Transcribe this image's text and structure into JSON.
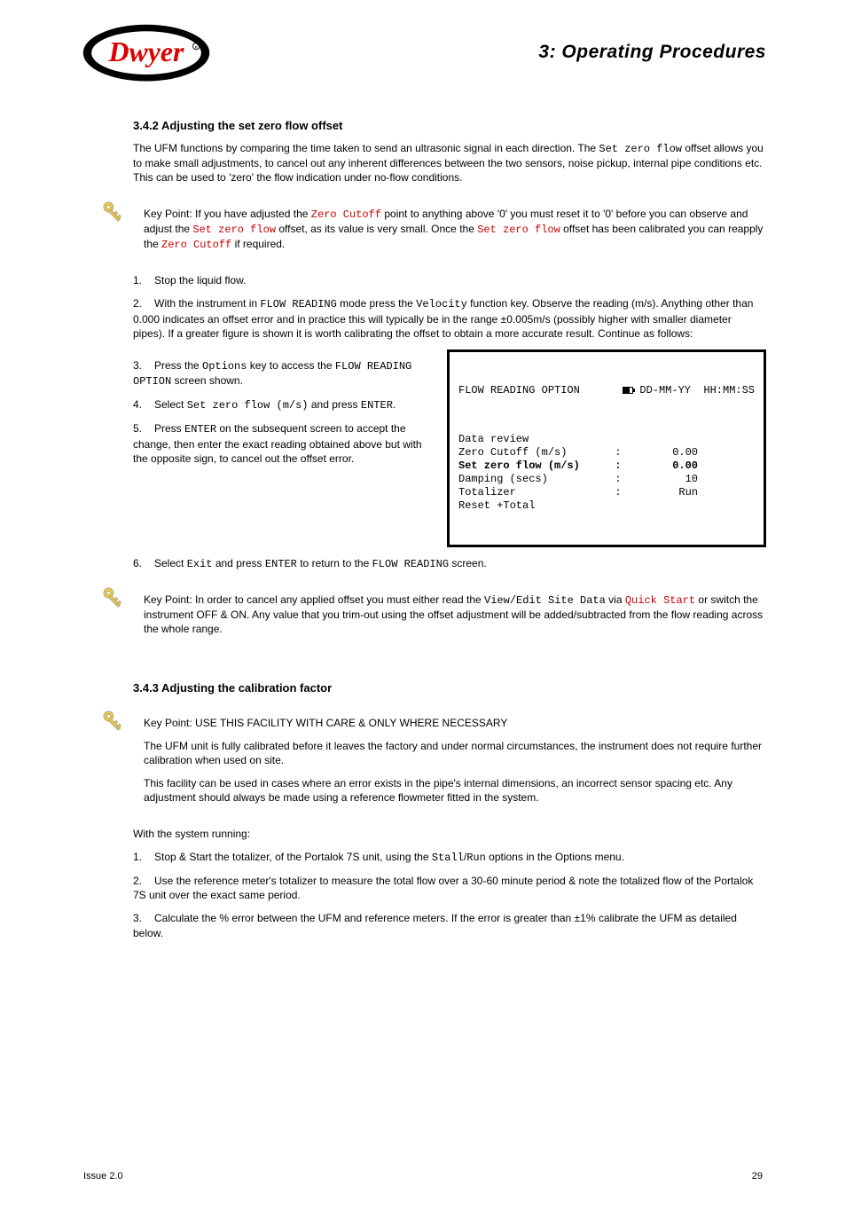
{
  "header": {
    "chapter": "3:  Operating Procedures",
    "logo_name": "dwyer-logo"
  },
  "section1": {
    "heading": "3.4.2 Adjusting the set zero flow offset",
    "para1_pre": "The UFM functions by comparing the time taken to send an ultrasonic signal in each direction. The ",
    "para1_code": "Set zero flow",
    "para1_post": " offset allows you to make small adjustments, to cancel out any inherent differences between the two sensors, noise pickup, internal pipe conditions etc. This can be used to 'zero' the flow indication under no-flow conditions.",
    "keypoint_pre": "If you have adjusted the ",
    "keypoint_k1": "Zero Cutoff",
    "keypoint_mid1": " point to anything above '0' you must reset it to '0' before you can observe and adjust the ",
    "keypoint_k2": "Set zero flow",
    "keypoint_mid2": " offset, as its value is very small. Once the ",
    "keypoint_k3": "Set zero flow",
    "keypoint_mid3": " offset has been calibrated you can reapply the ",
    "keypoint_k4": "Zero Cutoff",
    "keypoint_post": " if required.",
    "steps": {
      "s1": "Stop the liquid flow.",
      "s2_a": "With the instrument in ",
      "s2_code1": "FLOW READING",
      "s2_b": " mode press the ",
      "s2_code2": "Velocity",
      "s2_c": " function key. Observe the reading (m/s). Anything other than 0.000 indicates an offset error and in practice this will typically be in the range ±0.005m/s (possibly higher with smaller diameter pipes). If a greater figure is shown it is worth calibrating the offset to obtain a more accurate result. Continue as follows:",
      "s3_a": "Press the ",
      "s3_code1": "Options",
      "s3_b": " key to access the ",
      "s3_code2": "FLOW READING OPTION",
      "s3_c": " screen shown.",
      "s4_a": "Select ",
      "s4_code1": "Set zero flow (m/s)",
      "s4_b": " and press ",
      "s4_code2": "ENTER",
      "s4_c": ".",
      "s5_a": "Press ",
      "s5_code1": "ENTER",
      "s5_b": " on the subsequent screen to accept the change, then enter the exact reading obtained above but with the opposite sign, to cancel out the offset error.",
      "s6_a": "Select ",
      "s6_code1": "Exit",
      "s6_b": " and press ",
      "s6_code2": "ENTER",
      "s6_c": " to return to the ",
      "s6_code3": "FLOW READING",
      "s6_d": " screen."
    }
  },
  "screen": {
    "title": "FLOW READING OPTION",
    "date": "DD-MM-YY",
    "time": "HH:MM:SS",
    "rows": [
      {
        "label": "Data review",
        "sep": "",
        "val": "",
        "bold": false
      },
      {
        "label": "Zero Cutoff (m/s)",
        "sep": ":",
        "val": "0.00",
        "bold": false
      },
      {
        "label": "Set zero flow (m/s)",
        "sep": ":",
        "val": "0.00",
        "bold": true
      },
      {
        "label": "Damping (secs)",
        "sep": ":",
        "val": "10",
        "bold": false
      },
      {
        "label": "Totalizer",
        "sep": ":",
        "val": "Run",
        "bold": false
      },
      {
        "label": "Reset +Total",
        "sep": "",
        "val": "",
        "bold": false
      }
    ]
  },
  "note1_pre": "In order to cancel any applied offset you must either read the ",
  "note1_mid": " via ",
  "note1_k1": "Quick Start",
  "note1_post": " or switch the instrument OFF & ON. Any value that you trim-out using the offset adjustment will be added/subtracted from the flow reading across the whole range.",
  "note1_code_view": "View/Edit Site Data",
  "section2": {
    "heading": "3.4.3 Adjusting the calibration factor",
    "keypoint": "USE THIS FACILITY WITH CARE & ONLY WHERE NECESSARY",
    "keypoint2": "The UFM unit is fully calibrated before it leaves the factory and under normal circumstances, the instrument does not require further calibration when used on site.",
    "keypoint3": "This facility can be used in cases where an error exists in the pipe's internal dimensions, an incorrect sensor spacing etc. Any adjustment should always be made using a reference flowmeter fitted in the system."
  },
  "para_below": "With the system running:",
  "steps2": {
    "s1_a": "Stop & Start the totalizer, of the Portalok 7S unit, using the ",
    "s1_code1": "Stall",
    "s1_b": "/",
    "s1_code2": "Run",
    "s1_c": " options in the Options menu.",
    "s2": "Use the reference meter's totalizer to measure the total flow over a 30-60 minute period & note the totalized flow of the Portalok 7S unit over the exact same period.",
    "s3": "Calculate the % error between the UFM and reference meters. If the error is greater than ±1% calibrate the UFM as detailed below."
  },
  "footer": {
    "left": "Issue 2.0",
    "right": "29"
  }
}
